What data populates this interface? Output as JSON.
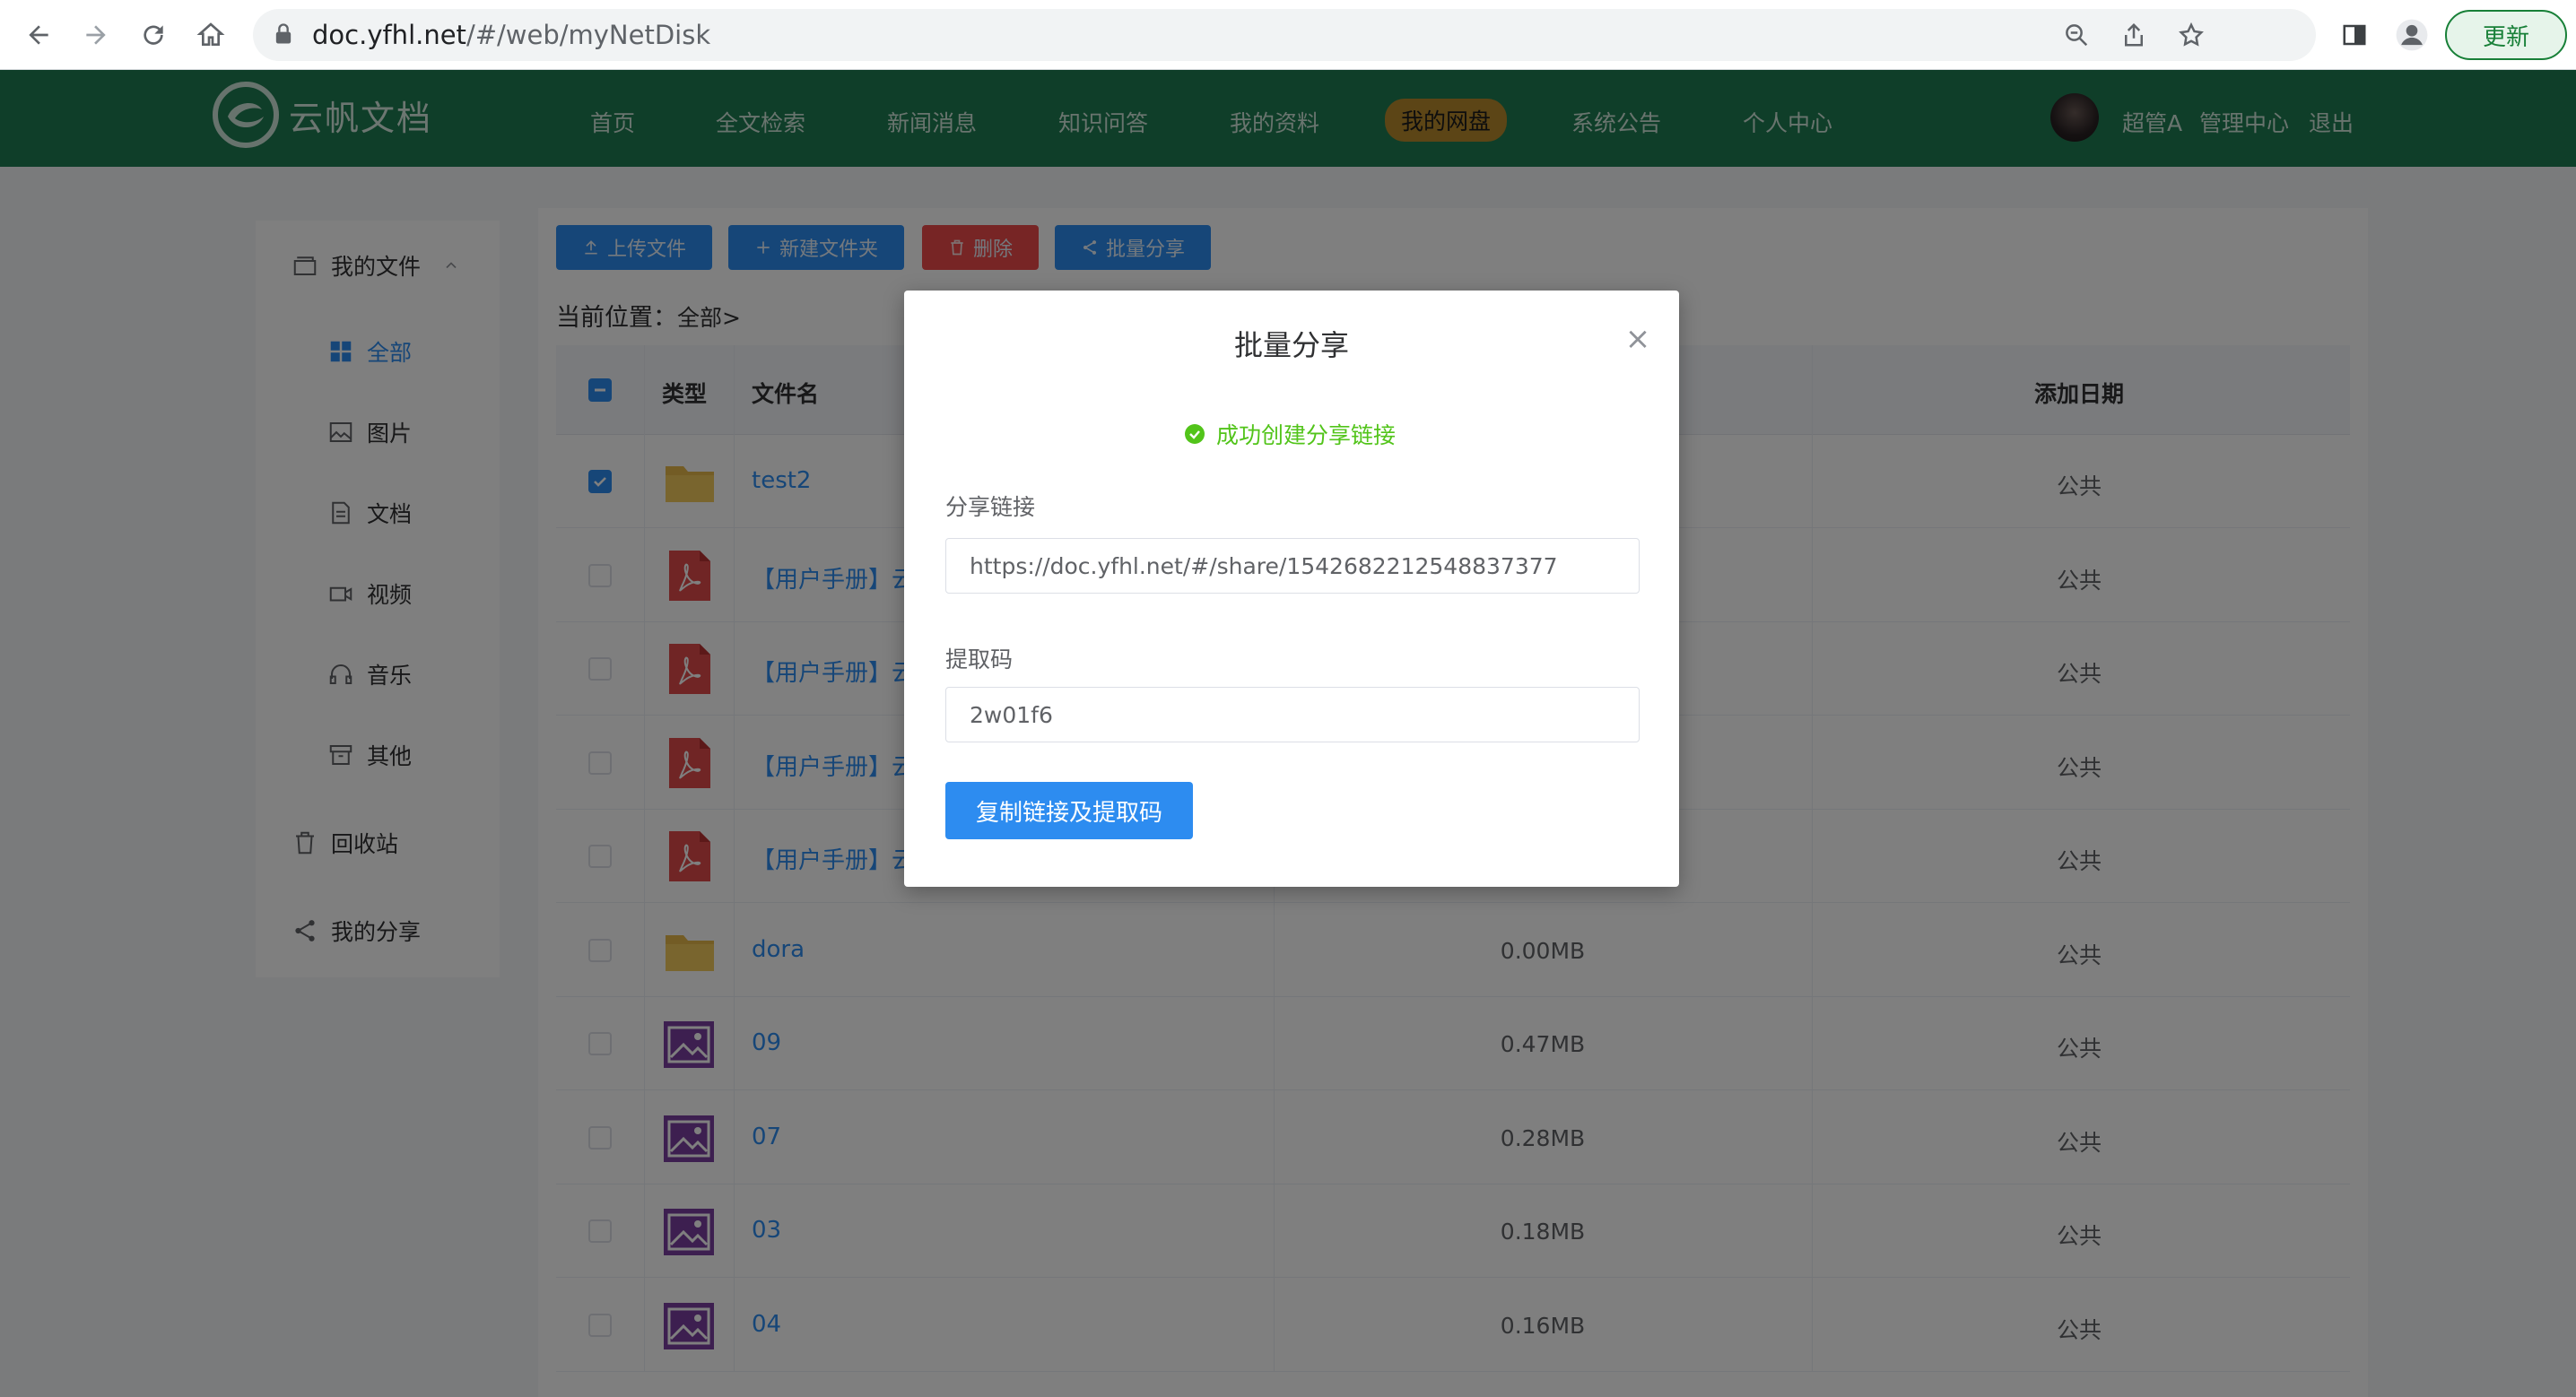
{
  "browser": {
    "url_host": "doc.yfhl.net",
    "url_path": "/#/web/myNetDisk",
    "update_label": "更新"
  },
  "header": {
    "logo_text": "云帆文档",
    "nav": [
      "首页",
      "全文检索",
      "新闻消息",
      "知识问答",
      "我的资料",
      "我的网盘",
      "系统公告",
      "个人中心"
    ],
    "active_nav": "我的网盘",
    "user_name": "超管A",
    "admin_link": "管理中心",
    "logout_link": "退出"
  },
  "sidebar": {
    "group_label": "我的文件",
    "items": [
      {
        "label": "全部",
        "icon": "grid-icon",
        "active": true
      },
      {
        "label": "图片",
        "icon": "image-icon"
      },
      {
        "label": "文档",
        "icon": "document-icon"
      },
      {
        "label": "视频",
        "icon": "video-icon"
      },
      {
        "label": "音乐",
        "icon": "headphones-icon"
      },
      {
        "label": "其他",
        "icon": "archive-icon"
      }
    ],
    "recycle_label": "回收站",
    "share_label": "我的分享"
  },
  "toolbar": {
    "upload_label": "上传文件",
    "new_folder_label": "新建文件夹",
    "delete_label": "删除",
    "batch_share_label": "批量分享"
  },
  "breadcrumb": {
    "label": "当前位置：",
    "path": "全部>"
  },
  "table": {
    "headers": {
      "type": "类型",
      "name": "文件名",
      "date": "添加日期"
    },
    "rows": [
      {
        "type": "folder",
        "name": "test2",
        "size": "",
        "perm": "公共",
        "checked": true
      },
      {
        "type": "pdf",
        "name": "【用户手册】云",
        "size": "",
        "perm": "公共",
        "checked": false
      },
      {
        "type": "pdf",
        "name": "【用户手册】云",
        "size": "",
        "perm": "公共",
        "checked": false
      },
      {
        "type": "pdf",
        "name": "【用户手册】云",
        "size": "",
        "perm": "公共",
        "checked": false
      },
      {
        "type": "pdf",
        "name": "【用户手册】云",
        "size": "",
        "perm": "公共",
        "checked": false
      },
      {
        "type": "folder",
        "name": "dora",
        "size": "0.00MB",
        "perm": "公共",
        "checked": false
      },
      {
        "type": "image",
        "name": "09",
        "size": "0.47MB",
        "perm": "公共",
        "checked": false
      },
      {
        "type": "image",
        "name": "07",
        "size": "0.28MB",
        "perm": "公共",
        "checked": false
      },
      {
        "type": "image",
        "name": "03",
        "size": "0.18MB",
        "perm": "公共",
        "checked": false
      },
      {
        "type": "image",
        "name": "04",
        "size": "0.16MB",
        "perm": "公共",
        "checked": false
      }
    ]
  },
  "modal": {
    "title": "批量分享",
    "success_message": "成功创建分享链接",
    "link_label": "分享链接",
    "link_value": "https://doc.yfhl.net/#/share/1542682212548837377",
    "code_label": "提取码",
    "code_value": "2w01f6",
    "copy_button_label": "复制链接及提取码"
  },
  "colors": {
    "header_green": "#1f7c52",
    "primary_blue": "#2d8cf0",
    "danger_red": "#ee4b4b",
    "success_green": "#52c41a",
    "active_nav_gold": "#b88a2c"
  }
}
